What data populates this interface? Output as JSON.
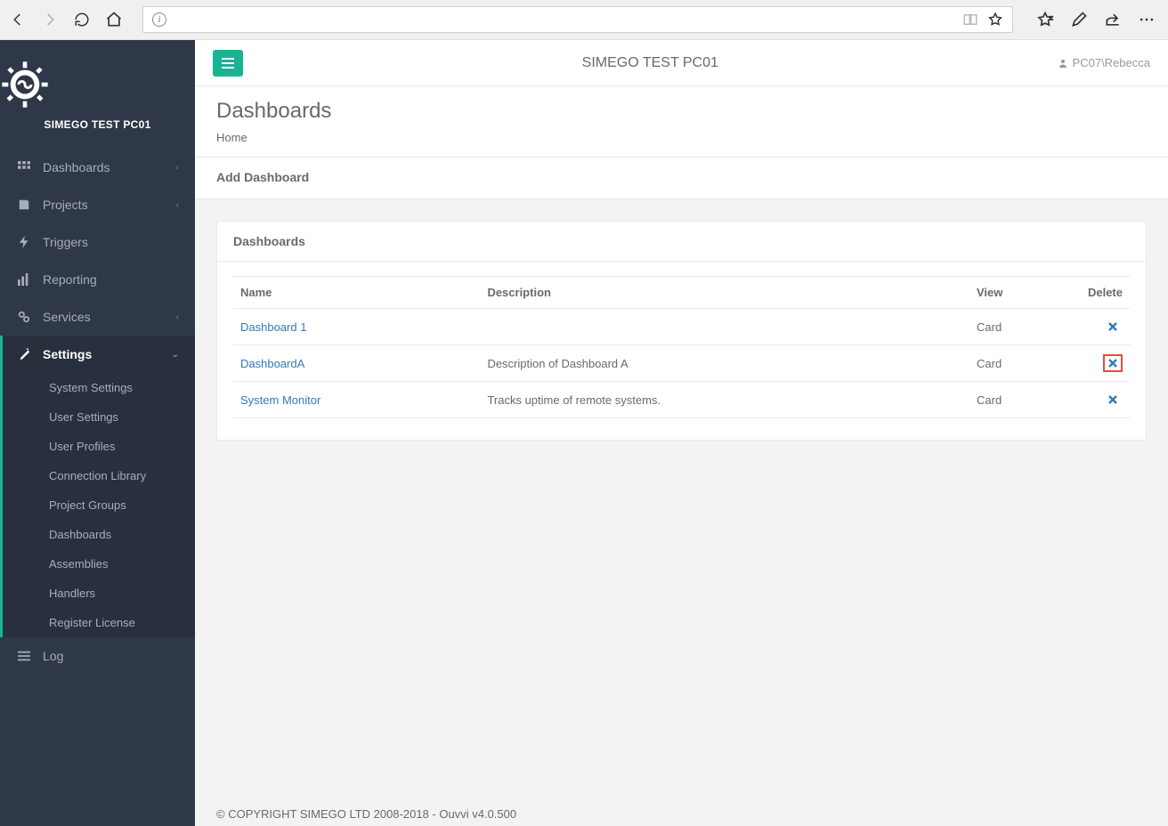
{
  "browser": {
    "url": ""
  },
  "sidebar": {
    "brand": "SIMEGO TEST PC01",
    "items": [
      {
        "label": "Dashboards",
        "expandable": true
      },
      {
        "label": "Projects",
        "expandable": true
      },
      {
        "label": "Triggers",
        "expandable": false
      },
      {
        "label": "Reporting",
        "expandable": false
      },
      {
        "label": "Services",
        "expandable": true
      },
      {
        "label": "Settings",
        "expandable": true,
        "active": true
      },
      {
        "label": "Log",
        "expandable": false
      }
    ],
    "settings_sub": [
      "System Settings",
      "User Settings",
      "User Profiles",
      "Connection Library",
      "Project Groups",
      "Dashboards",
      "Assemblies",
      "Handlers",
      "Register License"
    ]
  },
  "topbar": {
    "title": "SIMEGO TEST PC01",
    "user": "PC07\\Rebecca"
  },
  "page": {
    "title": "Dashboards",
    "breadcrumb": "Home",
    "add_label": "Add Dashboard",
    "panel_title": "Dashboards"
  },
  "table": {
    "headers": {
      "name": "Name",
      "description": "Description",
      "view": "View",
      "delete": "Delete"
    },
    "rows": [
      {
        "name": "Dashboard 1",
        "description": "",
        "view": "Card",
        "highlight_delete": false
      },
      {
        "name": "DashboardA",
        "description": "Description of Dashboard A",
        "view": "Card",
        "highlight_delete": true
      },
      {
        "name": "System Monitor",
        "description": "Tracks uptime of remote systems.",
        "view": "Card",
        "highlight_delete": false
      }
    ]
  },
  "footer": "© COPYRIGHT SIMEGO LTD 2008-2018 - Ouvvi v4.0.500"
}
